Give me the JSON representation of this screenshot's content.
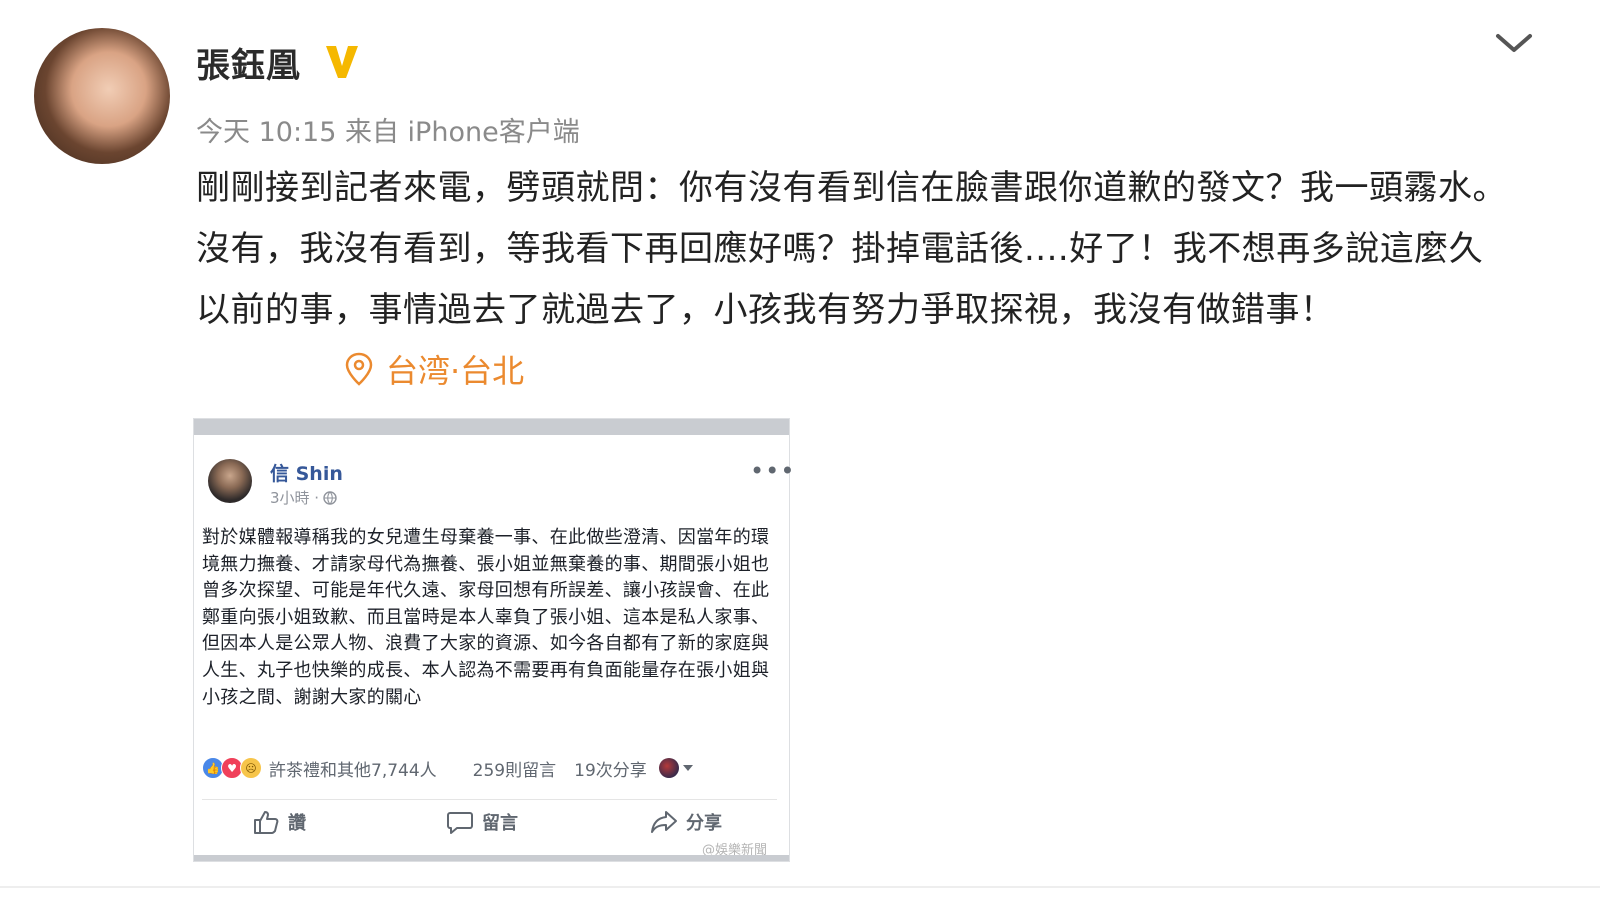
{
  "weibo_post": {
    "author": "張鈺凰",
    "verified_badge": "V",
    "meta": "今天 10:15 来自 iPhone客户端",
    "text": "剛剛接到記者來電，劈頭就問：你有沒有看到信在臉書跟你道歉的發文？我一頭霧水。沒有，我沒有看到，等我看下再回應好嗎？掛掉電話後....好了！我不想再多說這麼久以前的事，事情過去了就過去了，小孩我有努力爭取探視，我沒有做錯事！",
    "location": "台湾·台北",
    "accent_color": "#eb8a2f"
  },
  "facebook_post": {
    "author": "信 Shin",
    "time": "3小時 ·",
    "more_label": "•••",
    "body": "對於媒體報導稱我的女兒遭生母棄養一事、在此做些澄清、因當年的環境無力撫養、才請家母代為撫養、張小姐並無棄養的事、期間張小姐也曾多次探望、可能是年代久遠、家母回想有所誤差、讓小孩誤會、在此鄭重向張小姐致歉、而且當時是本人辜負了張小姐、這本是私人家事、但因本人是公眾人物、浪費了大家的資源、如今各自都有了新的家庭與人生、丸子也快樂的成長、本人認為不需要再有負面能量存在張小姐與小孩之間、謝謝大家的關心",
    "stats": {
      "likes": "許茶禮和其他7,744人",
      "comments": "259則留言",
      "shares": "19次分享"
    },
    "actions": {
      "like": "讚",
      "comment": "留言",
      "share": "分享"
    },
    "watermark": "@娛樂新聞",
    "link_color": "#365899"
  }
}
